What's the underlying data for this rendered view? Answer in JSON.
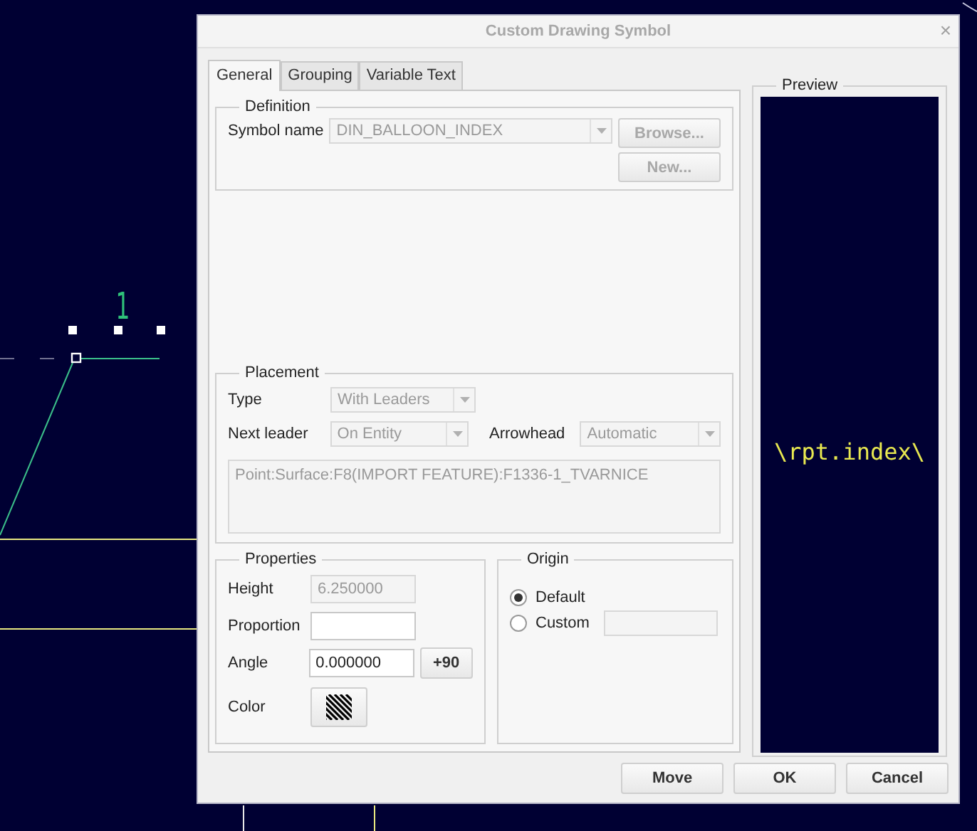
{
  "canvas": {
    "balloon_text": "1"
  },
  "window": {
    "title": "Custom Drawing Symbol",
    "close": "×"
  },
  "tabs": [
    {
      "label": "General",
      "selected": true
    },
    {
      "label": "Grouping",
      "selected": false
    },
    {
      "label": "Variable Text",
      "selected": false
    }
  ],
  "definition": {
    "title": "Definition",
    "symbol_name_label": "Symbol name",
    "symbol_name": "DIN_BALLOON_INDEX",
    "symbol_name_disabled": true,
    "buttons": [
      {
        "label": "Browse...",
        "disabled": true
      },
      {
        "label": "New...",
        "disabled": true
      }
    ]
  },
  "placement": {
    "title": "Placement",
    "type_label": "Type",
    "type": "With Leaders",
    "next_leader_label": "Next leader",
    "next_leader": "On Entity",
    "arrowhead_label": "Arrowhead",
    "arrowhead": "Automatic",
    "disabled": true,
    "references": "Point:Surface:F8(IMPORT FEATURE):F1336-1_TVARNICE"
  },
  "properties": {
    "title": "Properties",
    "fields": [
      {
        "label": "Height",
        "value": "6.250000",
        "disabled": true
      },
      {
        "label": "Proportion",
        "disabled": false
      },
      {
        "label": "Angle",
        "value": "0.000000",
        "disabled": false,
        "button": "+90"
      }
    ],
    "color_label": "Color"
  },
  "origin": {
    "title": "Origin",
    "options": [
      {
        "label": "Default",
        "selected": true
      },
      {
        "label": "Custom",
        "selected": false
      }
    ]
  },
  "preview": {
    "title": "Preview",
    "text": "\\rpt.index\\"
  },
  "buttons": [
    "Move",
    "OK",
    "Cancel"
  ]
}
